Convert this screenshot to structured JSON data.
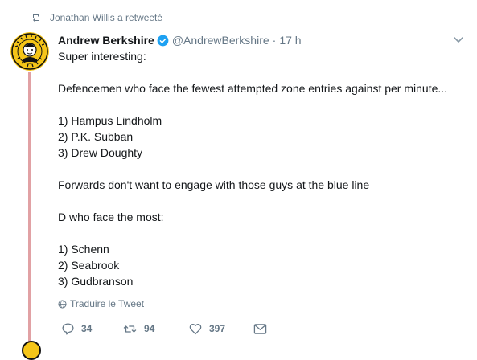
{
  "retweet_context": {
    "text": "Jonathan Willis a retweeté",
    "icon": "retweet-icon"
  },
  "tweet": {
    "author_name": "Andrew Berkshire",
    "verified": true,
    "handle": "@AndrewBerkshire",
    "separator": "·",
    "time": "17 h",
    "lines": [
      "Super interesting:",
      "",
      "Defencemen who face the fewest attempted zone entries against per minute...",
      "",
      "1) Hampus Lindholm",
      "2) P.K. Subban",
      "3) Drew Doughty",
      "",
      "Forwards don't want to engage with those guys at the blue line",
      "",
      "D who face the most:",
      "",
      "1) Schenn",
      "2) Seabrook",
      "3) Gudbranson"
    ],
    "translate_label": "Traduire le Tweet"
  },
  "actions": {
    "reply_count": "34",
    "retweet_count": "94",
    "like_count": "397"
  },
  "colors": {
    "accent": "#1da1f2",
    "secondary_text": "#657786",
    "thread_line": "#e1a1a4",
    "avatar_yellow": "#f5c518"
  }
}
